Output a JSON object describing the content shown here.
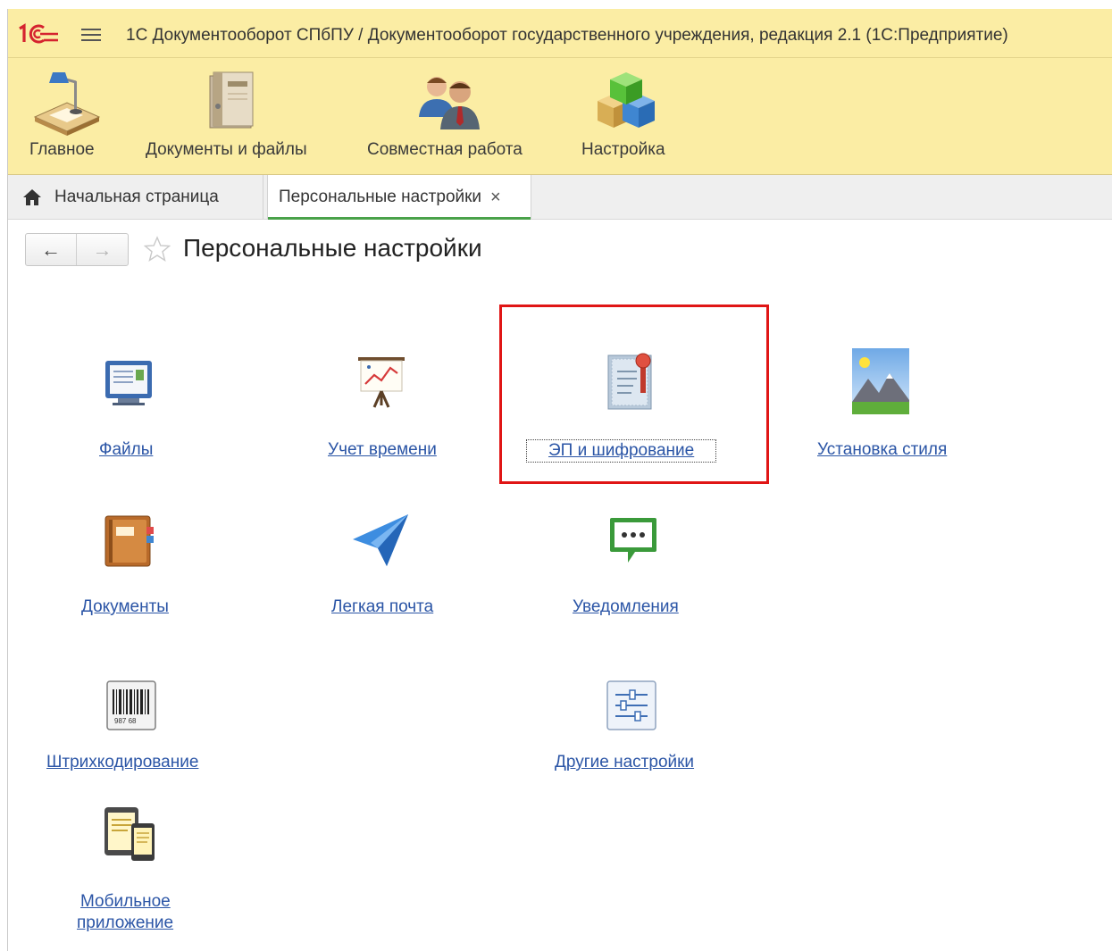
{
  "titlebar": {
    "logo": "1С",
    "menu_icon": "hamburger-icon",
    "title": "1С Документооборот СПбПУ / Документооборот государственного учреждения, редакция 2.1  (1С:Предприятие)"
  },
  "sections": [
    {
      "label": "Главное",
      "icon": "desk-lamp-icon"
    },
    {
      "label": "Документы и файлы",
      "icon": "binder-icon"
    },
    {
      "label": "Совместная работа",
      "icon": "people-icon"
    },
    {
      "label": "Настройка",
      "icon": "cubes-icon"
    }
  ],
  "tabs": {
    "home": {
      "label": "Начальная страница",
      "icon": "home-icon"
    },
    "active": {
      "label": "Персональные настройки",
      "close": "×"
    }
  },
  "header": {
    "back": "←",
    "forward": "→",
    "title": "Персональные настройки"
  },
  "items": [
    {
      "label": "Файлы",
      "icon": "files-monitor-icon"
    },
    {
      "label": "Учет времени",
      "icon": "presentation-chart-icon"
    },
    {
      "label": "ЭП и шифрование",
      "icon": "certificate-icon"
    },
    {
      "label": "Установка стиля",
      "icon": "landscape-picture-icon"
    },
    {
      "label": "Документы",
      "icon": "notebook-icon"
    },
    {
      "label": "Легкая почта",
      "icon": "paper-plane-icon"
    },
    {
      "label": "Уведомления",
      "icon": "chat-bubble-icon"
    },
    {
      "label": "Штрихкодирование",
      "icon": "barcode-icon"
    },
    {
      "label": "Другие настройки",
      "icon": "sliders-icon"
    },
    {
      "label_line1": "Мобильное",
      "label_line2": "приложение",
      "icon": "mobile-devices-icon"
    }
  ],
  "barcode_text": "987 68",
  "colors": {
    "panel_bg": "#fbeda4",
    "link": "#2b55a6",
    "highlight": "#e01515",
    "active_tab_accent": "#4aa24a"
  }
}
